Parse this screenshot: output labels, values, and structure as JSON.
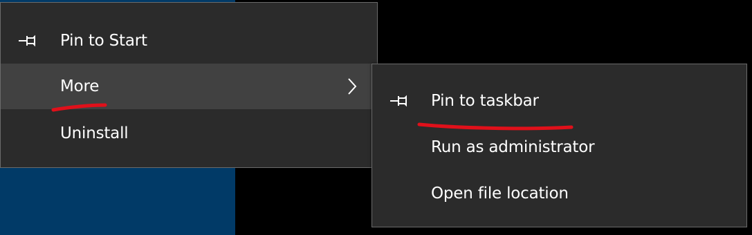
{
  "main_menu": {
    "items": [
      {
        "label": "Pin to Start",
        "icon": "pin-icon"
      },
      {
        "label": "More",
        "icon": "chevron-right-icon",
        "has_submenu": true,
        "highlighted": true
      },
      {
        "label": "Uninstall"
      }
    ]
  },
  "sub_menu": {
    "items": [
      {
        "label": "Pin to taskbar",
        "icon": "pin-icon"
      },
      {
        "label": "Run as administrator"
      },
      {
        "label": "Open file location"
      }
    ]
  },
  "colors": {
    "menu_background": "#2b2b2b",
    "menu_highlight": "#414141",
    "menu_border": "#6b6b6b",
    "text": "#ffffff",
    "desktop_blue": "#013a67",
    "annotation_red": "#e0101a"
  }
}
